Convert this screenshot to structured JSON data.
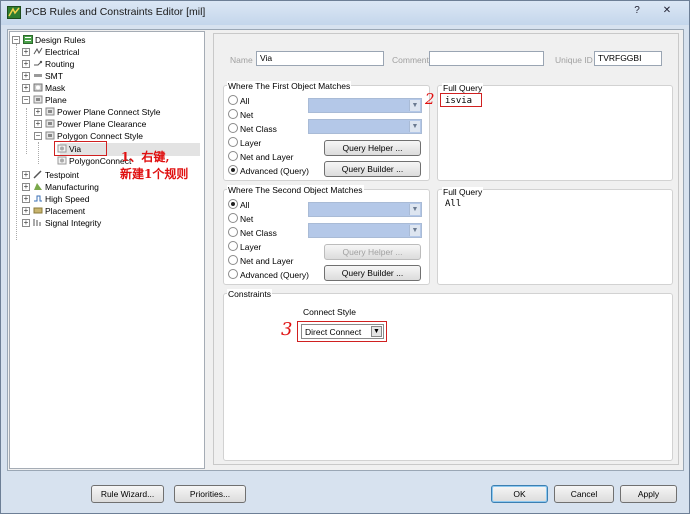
{
  "window": {
    "title": "PCB Rules and Constraints Editor [mil]",
    "help_glyph": "?",
    "close_glyph": "✕"
  },
  "tree": {
    "root": "Design Rules",
    "items": [
      {
        "label": "Electrical"
      },
      {
        "label": "Routing"
      },
      {
        "label": "SMT"
      },
      {
        "label": "Mask"
      },
      {
        "label": "Plane"
      },
      {
        "label": "Power Plane Connect Style"
      },
      {
        "label": "Power Plane Clearance"
      },
      {
        "label": "Polygon Connect Style"
      },
      {
        "label": "Via"
      },
      {
        "label": "PolygonConnect"
      },
      {
        "label": "Testpoint"
      },
      {
        "label": "Manufacturing"
      },
      {
        "label": "High Speed"
      },
      {
        "label": "Placement"
      },
      {
        "label": "Signal Integrity"
      }
    ]
  },
  "annotations": {
    "a1_line1": "1、右键,",
    "a1_line2": "新建1个规则",
    "a2": "2",
    "a3": "3"
  },
  "rule": {
    "name_label": "Name",
    "name_value": "Via",
    "comment_label": "Comment",
    "comment_value": "",
    "unique_label": "Unique ID",
    "unique_value": "TVRFGGBI"
  },
  "first": {
    "title": "Where The First Object Matches",
    "options": [
      "All",
      "Net",
      "Net Class",
      "Layer",
      "Net and Layer",
      "Advanced (Query)"
    ],
    "selected": "Advanced (Query)",
    "query_helper": "Query Helper ...",
    "query_builder": "Query Builder ...",
    "full_query_title": "Full Query",
    "full_query": "isvia"
  },
  "second": {
    "title": "Where The Second Object Matches",
    "options": [
      "All",
      "Net",
      "Net Class",
      "Layer",
      "Net and Layer",
      "Advanced (Query)"
    ],
    "selected": "All",
    "query_helper": "Query Helper ...",
    "query_builder": "Query Builder ...",
    "full_query_title": "Full Query",
    "full_query": "All"
  },
  "constraints": {
    "title": "Constraints",
    "connect_style_label": "Connect Style",
    "connect_style_value": "Direct Connect"
  },
  "footer": {
    "rule_wizard": "Rule Wizard...",
    "priorities": "Priorities...",
    "ok": "OK",
    "cancel": "Cancel",
    "apply": "Apply"
  },
  "colors": {
    "annotation": "#e01010",
    "combo_fill": "#b4c8e8",
    "title_bar": "#c4d6eb"
  }
}
